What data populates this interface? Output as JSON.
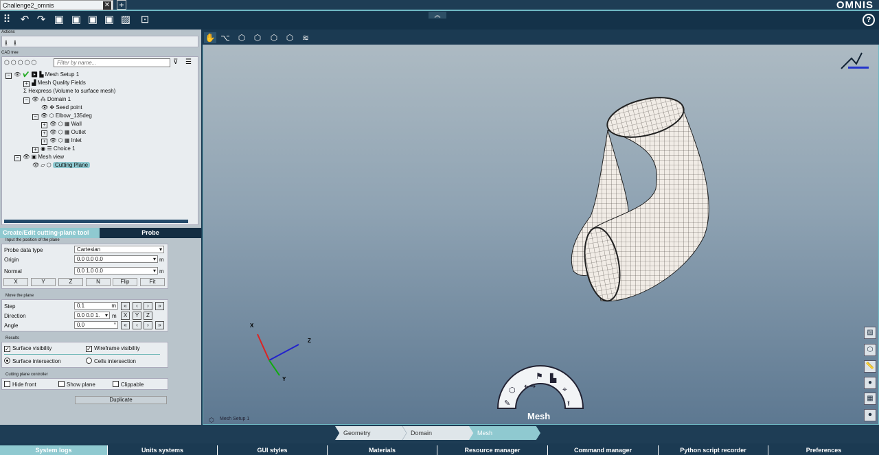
{
  "window": {
    "tab_title": "Challenge2_omnis",
    "logo": "OMNIS"
  },
  "toolbar": {
    "icons": [
      "grid-icon",
      "undo-icon",
      "redo-icon",
      "save-icon",
      "save-as-icon",
      "save-up-icon",
      "save-all-icon",
      "image-icon",
      "export-icon"
    ],
    "help": "?"
  },
  "left": {
    "actions_header": "Actions",
    "cad_header": "CAD tree",
    "filter_placeholder": "Filter by name...",
    "tree": [
      "Mesh Setup 1",
      "Mesh Quality Fields",
      "Hexpress (Volume to surface mesh)",
      "Domain 1",
      "Seed point",
      "Elbow_135deg",
      "Wall",
      "Outlet",
      "Inlet",
      "Choice 1",
      "Mesh view",
      "Cutting Plane"
    ]
  },
  "tabs": {
    "active": "Create/Edit cutting-plane tool",
    "other": "Probe"
  },
  "position": {
    "header": "Input the position of the plane",
    "probe_label": "Probe data type",
    "probe_value": "Cartesian",
    "origin_label": "Origin",
    "origin_value": "0.0 0.0 0.0",
    "origin_unit": "m",
    "normal_label": "Normal",
    "normal_value": "0.0 1.0 0.0",
    "normal_unit": "m",
    "buttons": [
      "X",
      "Y",
      "Z",
      "N",
      "Flip",
      "Fit"
    ]
  },
  "move": {
    "header": "Move the plane",
    "step_label": "Step",
    "step_value": "0.1",
    "step_unit": "m",
    "dir_label": "Direction",
    "dir_value": "0.0 0.0 1.",
    "dir_unit": "m",
    "angle_label": "Angle",
    "angle_value": "0.0",
    "angle_unit": "°",
    "axes": [
      "X",
      "Y",
      "Z"
    ]
  },
  "results": {
    "header": "Results",
    "surface_vis": "Surface visibility",
    "wire_vis": "Wireframe visibility",
    "surface_int": "Surface intersection",
    "cells_int": "Cells intersection"
  },
  "controller": {
    "header": "Cutting plane controller",
    "hide_front": "Hide front",
    "show_plane": "Show plane",
    "clippable": "Clippable",
    "duplicate": "Duplicate"
  },
  "viewport": {
    "axes": {
      "x": "X",
      "y": "Y",
      "z": "Z"
    },
    "mesh_menu_label": "Mesh",
    "status": "Mesh Setup 1"
  },
  "breadcrumb": [
    "Geometry",
    "Domain",
    "Mesh"
  ],
  "bottom_tabs": [
    "System logs",
    "Units systems",
    "GUI styles",
    "Materials",
    "Resource manager",
    "Command manager",
    "Python script recorder",
    "Preferences"
  ],
  "colors": {
    "accent": "#8fc9d0",
    "dark": "#1b3a52",
    "viewport_top": "#afbcc4"
  }
}
